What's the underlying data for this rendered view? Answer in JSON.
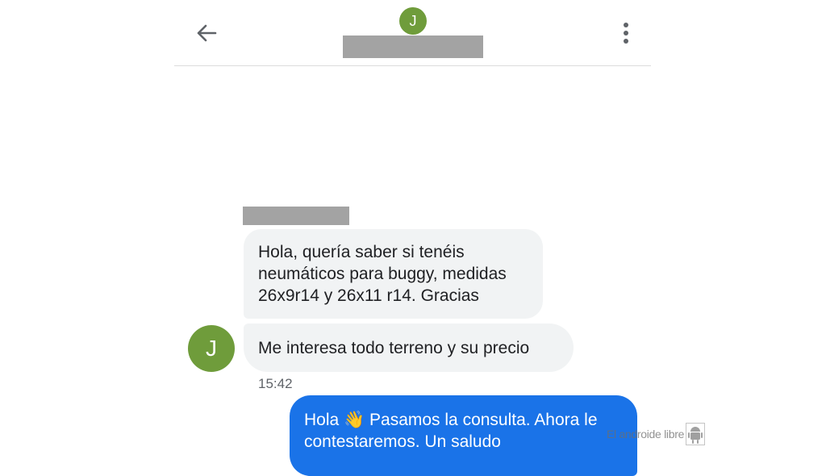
{
  "header": {
    "avatar_initial": "J",
    "avatar_color": "#6f9c3b"
  },
  "conversation": {
    "incoming_avatar_initial": "J",
    "messages": [
      {
        "direction": "incoming",
        "text_lines": [
          "Hola, quería saber si tenéis",
          "neumáticos para buggy, medidas",
          "26x9r14 y 26x11 r14. Gracias"
        ]
      },
      {
        "direction": "incoming",
        "text": "Me interesa todo terreno y su precio"
      },
      {
        "direction": "outgoing",
        "text_before_emoji": "Hola ",
        "emoji": "👋",
        "text_after_emoji": " Pasamos la consulta. Ahora le",
        "text_line2": "contestaremos. Un saludo"
      }
    ],
    "timestamp": "15:42"
  },
  "watermark": {
    "text": "El androide libre",
    "icon": "android-robot-icon"
  },
  "colors": {
    "incoming_bubble": "#f1f3f4",
    "outgoing_bubble": "#1a73e8",
    "redaction": "#a3a3a3"
  }
}
